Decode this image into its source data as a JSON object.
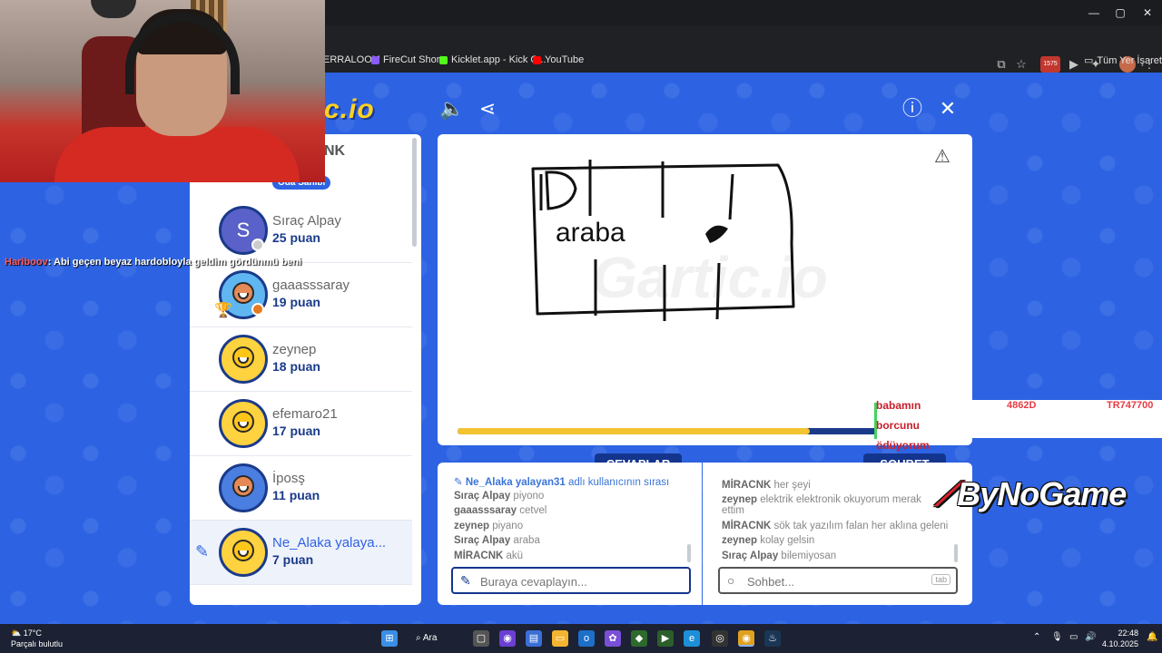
{
  "browser": {
    "window_controls": {
      "minimize": "—",
      "maximize": "▢",
      "close": "✕"
    },
    "bookmarks": [
      {
        "label": "ERRALOOM",
        "color": "#555"
      },
      {
        "label": "FireCut Shorts",
        "color": "#8a5cf6"
      },
      {
        "label": "Kicklet.app - Kick C...",
        "color": "#53fc18"
      },
      {
        "label": "YouTube",
        "color": "#ff0000"
      }
    ],
    "all_bookmarks": "Tüm Yer İşaretleri",
    "extension_badge": "1575"
  },
  "game": {
    "logo": "c.io",
    "room_owner_badge": "Oda Sahibi",
    "header_partial": "NK",
    "players": [
      {
        "name": "Sıraç Alpay",
        "points": "25 puan",
        "avatar_letter": "S"
      },
      {
        "name": "gaaasssaray",
        "points": "19 puan"
      },
      {
        "name": "zeynep",
        "points": "18 puan"
      },
      {
        "name": "efemaro21",
        "points": "17 puan"
      },
      {
        "name": "İposş",
        "points": "11 puan"
      },
      {
        "name": "Ne_Alaka yalaya...",
        "points": "7 puan"
      }
    ],
    "drawing_text": "araba",
    "watermark": "Gartic.io",
    "progress": 0.84,
    "tabs": {
      "answers": "CEVAPLAR",
      "chat": "SOHBET"
    },
    "answers": [
      {
        "user": "Ne_Alaka yalayan31",
        "text": "adlı kullanıcının sırası"
      },
      {
        "user": "Sıraç Alpay",
        "text": "piyono"
      },
      {
        "user": "gaaasssaray",
        "text": "cetvel"
      },
      {
        "user": "zeynep",
        "text": "piyano"
      },
      {
        "user": "Sıraç Alpay",
        "text": "araba"
      },
      {
        "user": "MİRACNK",
        "text": "akü"
      }
    ],
    "chat_messages": [
      {
        "user": "MİRACNK",
        "text": "her şeyi"
      },
      {
        "user": "zeynep",
        "text": "elektrik elektronik okuyorum merak"
      },
      {
        "user": "",
        "text": "ettim"
      },
      {
        "user": "MİRACNK",
        "text": "sök tak yazılım falan her aklına geleni"
      },
      {
        "user": "zeynep",
        "text": "kolay gelsin"
      },
      {
        "user": "Sıraç Alpay",
        "text": "bilemiyosan"
      }
    ],
    "answer_placeholder": "Buraya cevaplayın...",
    "chat_placeholder": "Sohbet...",
    "tab_key": "tab"
  },
  "overlay": {
    "stream_chat_user": "Hariboov",
    "stream_chat_text": ": Abi geçen beyaz hardobloyla geldim gördünmü beni",
    "ticker_words": [
      "babamın",
      "borcunu",
      "ödüyorum"
    ],
    "ticker_numbers": [
      "4862D",
      "TR747700"
    ],
    "sponsor": "ByNoGame"
  },
  "taskbar": {
    "temperature": "17°C",
    "weather": "Parçalı bulutlu",
    "search_label": "Ara",
    "time": "22:48",
    "date": "4.10.2025"
  }
}
